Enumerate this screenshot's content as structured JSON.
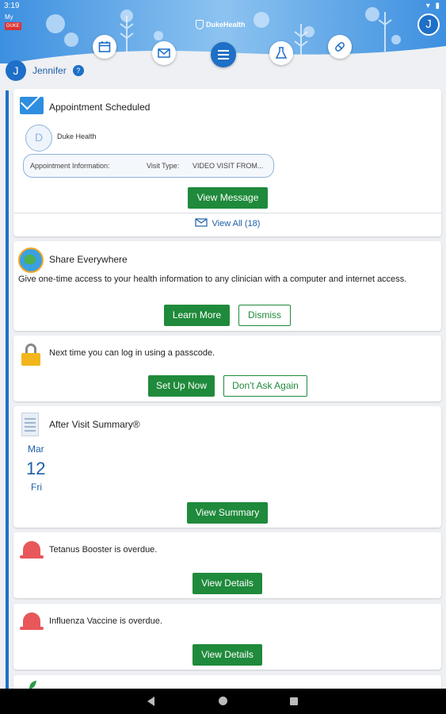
{
  "status": {
    "time": "3:19",
    "icons": "▾ ▮"
  },
  "app_badge": {
    "line1": "My",
    "line2": "DUKE"
  },
  "header": {
    "brand": "DukeHealth",
    "avatar_initial": "J"
  },
  "user": {
    "initial": "J",
    "name": "Jennifer",
    "help": "?"
  },
  "cards": {
    "appointment": {
      "title": "Appointment Scheduled",
      "sender_initial": "D",
      "sender": "Duke Health",
      "info_label": "Appointment Information:",
      "visit_type_label": "Visit Type:",
      "visit_type_value": "VIDEO VISIT FROM...",
      "button": "View Message",
      "view_all": "View All (18)"
    },
    "share": {
      "title": "Share Everywhere",
      "body": "Give one-time access to your health information to any clinician with a computer and internet access.",
      "primary": "Learn More",
      "secondary": "Dismiss"
    },
    "passcode": {
      "body": "Next time you can log in using a passcode.",
      "primary": "Set Up Now",
      "secondary": "Don't Ask Again"
    },
    "summary": {
      "title": "After Visit Summary®",
      "month": "Mar",
      "day": "12",
      "weekday": "Fri",
      "button": "View Summary"
    },
    "tetanus": {
      "body": "Tetanus Booster is overdue.",
      "button": "View Details"
    },
    "influenza": {
      "body": "Influenza Vaccine is overdue.",
      "button": "View Details"
    }
  },
  "colors": {
    "brand_blue": "#1e6fc7",
    "action_green": "#1f8a3b",
    "alert_red": "#e8575a"
  }
}
